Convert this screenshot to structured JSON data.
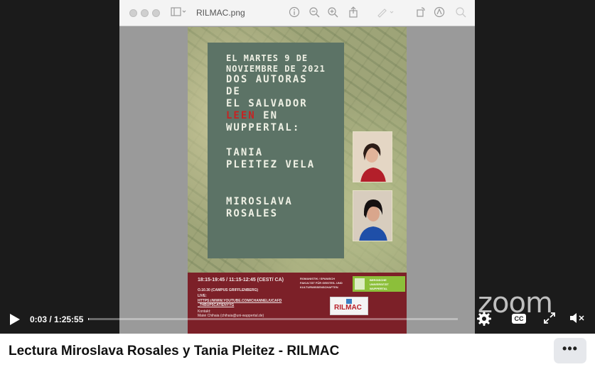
{
  "window": {
    "file_name": "RILMAC.png",
    "toolbar_icons": [
      "sidebar-icon",
      "info-icon",
      "zoom-out-icon",
      "zoom-in-icon",
      "share-icon",
      "markup-icon",
      "rotate-icon",
      "annotate-icon",
      "search-icon"
    ]
  },
  "poster": {
    "line1": "EL MARTES 9 DE",
    "line2": "NOVIEMBRE DE 2021",
    "line3": "DOS AUTORAS",
    "line4": "DE",
    "line5": "EL SALVADOR",
    "line6_red": "LEEN",
    "line6_rest": " EN",
    "line7": "WUPPERTAL:",
    "author1_line1": "TANIA",
    "author1_line2": "PLEITEZ VELA",
    "author2_line1": "MIROSLAVA",
    "author2_line2": "ROSALES",
    "footer_time": "18:15-19:45 / 11:15-12:45 (CEST/ CA)",
    "footer_room": "O.10.30 (CAMPUS GRIFFLENBERG)",
    "footer_live": "LIVE:",
    "footer_link1": "HTTPS://WWW.YOUTUBE.COM/CHANNEL/UCAFD",
    "footer_link2": "_7HBUP5CATIENYYG",
    "footer_contact": "Kontakt:",
    "footer_contact_person": "Matei Chihaia (chihaia@uni-wuppertal.de)",
    "footer_faculty1": "ROMANISTIK / SPANISCH",
    "footer_faculty2": "FAKULTÄT FÜR GEISTES- UND",
    "footer_faculty3": "KULTURWISSENSCHAFTEN",
    "uni_label1": "BERGISCHE",
    "uni_label2": "UNIVERSITÄT",
    "uni_label3": "WUPPERTAL",
    "logo": "RILMAC"
  },
  "watermark": "zoom",
  "controls": {
    "current_time": "0:03",
    "duration": "1:25:55",
    "time_display": "0:03 / 1:25:55",
    "progress_fraction": 0.0006,
    "cc_label": "CC"
  },
  "video_title": "Lectura Miroslava Rosales y Tania Pleitez - RILMAC",
  "more_label": "•••"
}
